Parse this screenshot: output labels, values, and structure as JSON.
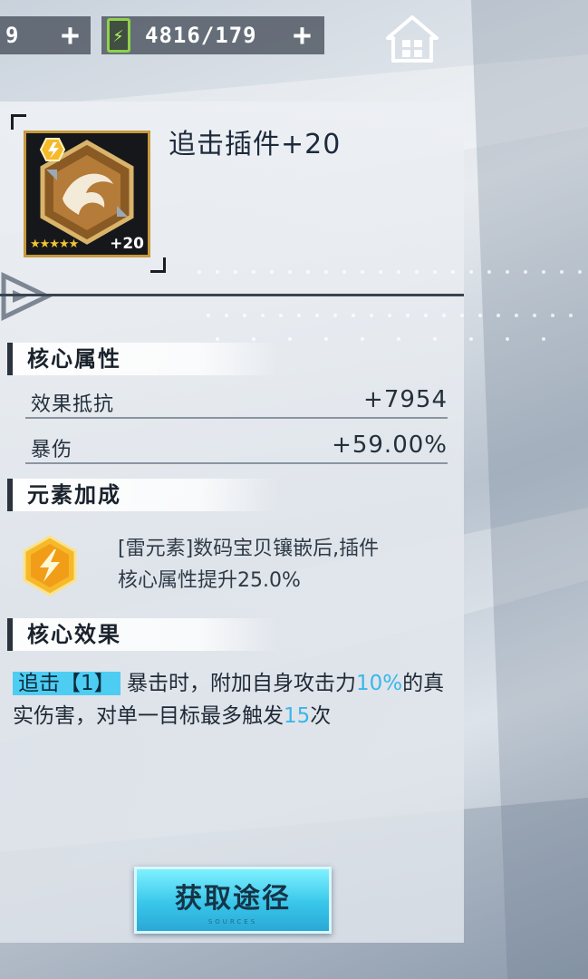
{
  "top_bar": {
    "resource_1_value": "9",
    "resource_2_value": "4816/179",
    "plus_symbol": "+"
  },
  "item": {
    "name": "追击插件+20",
    "stars": "★★★★★",
    "level": "+20"
  },
  "sections": {
    "core_attributes": {
      "title": "核心属性",
      "stats": [
        {
          "name": "效果抵抗",
          "value": "+7954"
        },
        {
          "name": "暴伤",
          "value": "+59.00%"
        }
      ]
    },
    "element_bonus": {
      "title": "元素加成",
      "text_line1": "[雷元素]数码宝贝镶嵌后,插件",
      "text_line2": "核心属性提升25.0%"
    },
    "core_effect": {
      "title": "核心效果",
      "tag": "追击【1】",
      "part1": "暴击时，附加自身攻击力",
      "num1": "10%",
      "part2": "的真实伤害，对单一目标最多触发",
      "num2": "15",
      "part3": "次"
    }
  },
  "acquire_button": {
    "label": "获取途径",
    "sublabel": "SOURCES"
  },
  "colors": {
    "accent_cyan": "#4ecdf3",
    "gold": "#c69a3c",
    "thunder_yellow": "#f5b92a"
  },
  "icons": [
    "plus-icon",
    "battery-icon",
    "home-icon",
    "thunder-element-icon",
    "item-emblem-icon"
  ]
}
